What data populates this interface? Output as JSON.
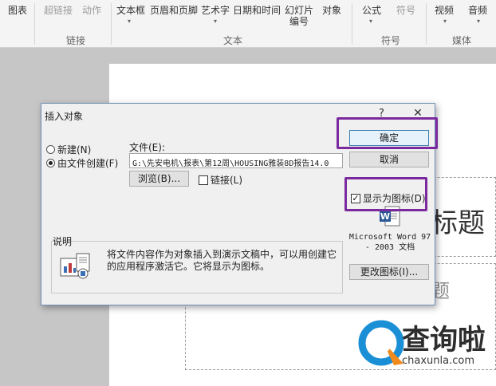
{
  "ribbon": {
    "charts": "图表",
    "hyperlink": "超链接",
    "action": "动作",
    "textbox": "文本框",
    "header_footer": "页眉和页脚",
    "wordart": "艺术字",
    "datetime": "日期和时间",
    "slide_number_1": "幻灯片",
    "slide_number_2": "编号",
    "object": "对象",
    "equation": "公式",
    "symbol": "符号",
    "video": "视频",
    "audio": "音频",
    "groups": {
      "links": "链接",
      "text": "文本",
      "symbols": "符号",
      "media": "媒体"
    }
  },
  "slide": {
    "title_fragment": "标题",
    "subtitle_fragment": "题"
  },
  "dialog": {
    "title": "插入对象",
    "help": "?",
    "close": "✕",
    "create_new": "新建(N)",
    "create_from_file": "由文件创建(F)",
    "selected_option": "create_from_file",
    "file_label": "文件(E):",
    "file_value": "G:\\先安电机\\报表\\第12周\\HOUSING雅装8D报告14.0",
    "browse": "浏览(B)...",
    "link_label": "链接(L)",
    "link_checked": false,
    "ok": "确定",
    "cancel": "取消",
    "display_as_icon": "显示为图标(D)",
    "display_as_icon_checked": true,
    "icon_caption_1": "Microsoft Word 97",
    "icon_caption_2": "- 2003 文档",
    "change_icon": "更改图标(I)...",
    "description_label": "说明",
    "description_text": "将文件内容作为对象插入到演示文稿中，可以用创建它的应用程序激活它。它将显示为图标。"
  },
  "watermark": {
    "text": "查询啦",
    "url": "chaxunla.com"
  },
  "colors": {
    "highlight": "#7a2a9e",
    "default_button_border": "#3c7fb1",
    "watermark_blue": "#1a8fd6"
  }
}
